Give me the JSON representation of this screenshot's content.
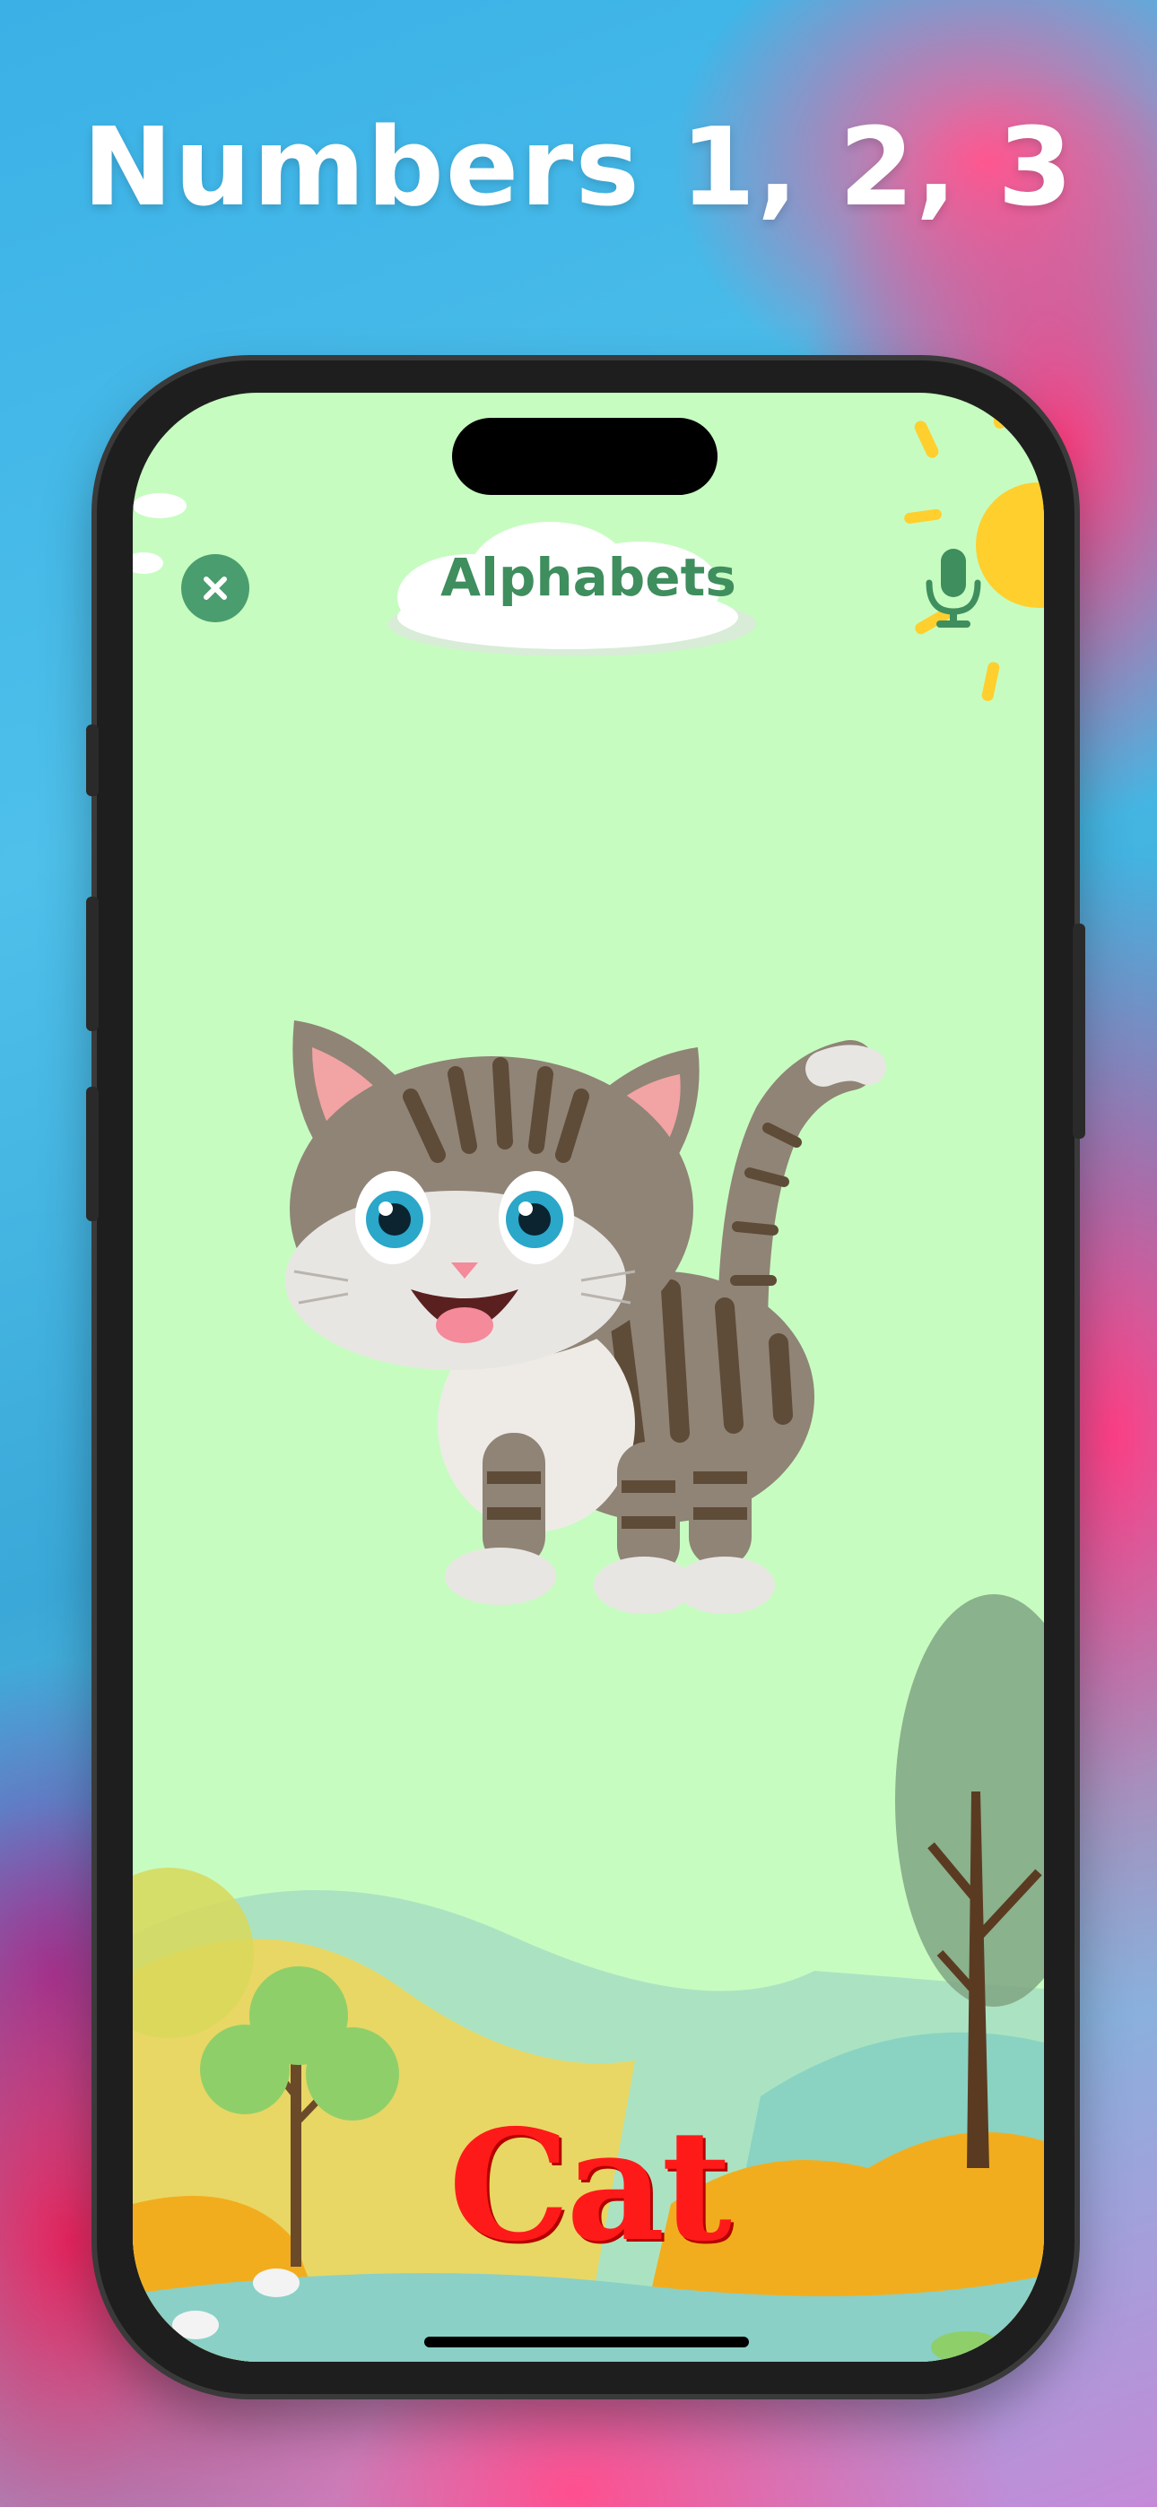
{
  "promo": {
    "headline": "Numbers 1, 2, 3"
  },
  "app": {
    "title": "Alphabets",
    "word": "Cat",
    "close_icon": "close-icon",
    "mic_icon": "microphone-icon",
    "picture": "cat-illustration"
  },
  "colors": {
    "screen_bg": "#c7fcc1",
    "accent_green": "#3f8e5e",
    "word_red": "#ff1a1a",
    "sun_yellow": "#ffcf2e"
  }
}
